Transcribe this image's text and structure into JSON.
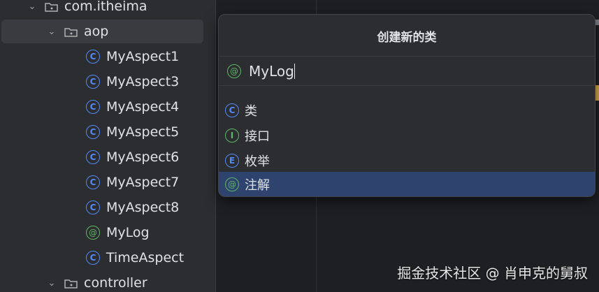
{
  "project_tree": {
    "items": [
      {
        "label": "com.itheima",
        "kind": "package",
        "expanded": true
      },
      {
        "label": "aop",
        "kind": "package",
        "expanded": true,
        "selected": true
      },
      {
        "label": "MyAspect1",
        "kind": "class"
      },
      {
        "label": "MyAspect3",
        "kind": "class"
      },
      {
        "label": "MyAspect4",
        "kind": "class"
      },
      {
        "label": "MyAspect5",
        "kind": "class"
      },
      {
        "label": "MyAspect6",
        "kind": "class"
      },
      {
        "label": "MyAspect7",
        "kind": "class"
      },
      {
        "label": "MyAspect8",
        "kind": "class"
      },
      {
        "label": "MyLog",
        "kind": "annotation"
      },
      {
        "label": "TimeAspect",
        "kind": "class"
      },
      {
        "label": "controller",
        "kind": "package",
        "expanded": true
      }
    ]
  },
  "dialog": {
    "title": "创建新的类",
    "name_value": "MyLog",
    "kinds": [
      {
        "label": "类",
        "icon": "class-icon"
      },
      {
        "label": "接口",
        "icon": "interface-icon"
      },
      {
        "label": "枚举",
        "icon": "enum-icon"
      },
      {
        "label": "注解",
        "icon": "annotation-icon",
        "selected": true
      }
    ]
  },
  "watermark": "掘金技术社区 @ 肖申克的舅叔",
  "colors": {
    "background": "#1e1f22",
    "panel": "#2b2d30",
    "selection": "#2e436e",
    "class_icon": "#548af7",
    "annotation_icon": "#5fb865"
  }
}
